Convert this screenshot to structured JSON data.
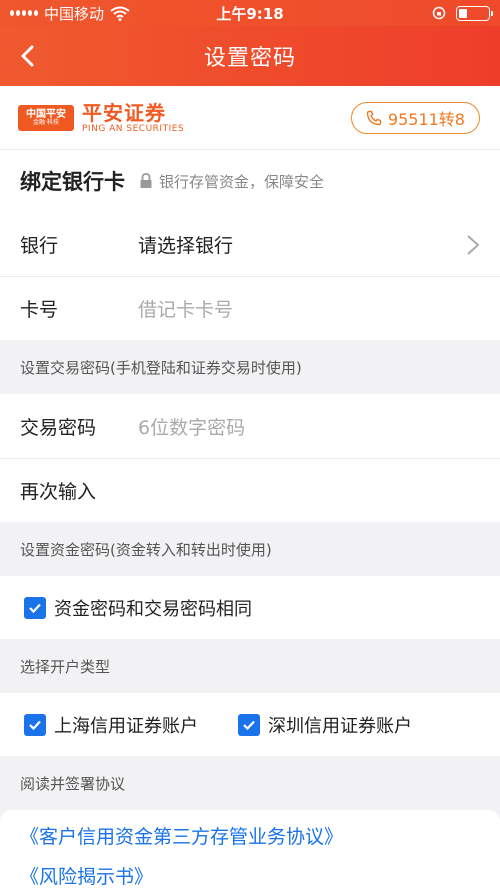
{
  "status": {
    "carrier": "中国移动",
    "time": "上午9:18"
  },
  "nav": {
    "title": "设置密码"
  },
  "brand": {
    "logo_text": "中国平安",
    "logo_sub": "金融·科技",
    "name_cn": "平安证券",
    "name_en": "PING AN SECURITIES",
    "hotline": "95511转8",
    "accent": "#f05a22"
  },
  "bind_card": {
    "title": "绑定银行卡",
    "note": "银行存管资金，保障安全",
    "bank": {
      "label": "银行",
      "value": "请选择银行"
    },
    "card": {
      "label": "卡号",
      "placeholder": "借记卡卡号"
    }
  },
  "trade_pwd": {
    "group_label": "设置交易密码(手机登陆和证券交易时使用)",
    "pwd": {
      "label": "交易密码",
      "placeholder": "6位数字密码"
    },
    "confirm": {
      "label": "再次输入",
      "placeholder": ""
    }
  },
  "fund_pwd": {
    "group_label": "设置资金密码(资金转入和转出时使用)",
    "same_label": "资金密码和交易密码相同",
    "same_checked": true
  },
  "account_type": {
    "group_label": "选择开户类型",
    "options": [
      {
        "label": "上海信用证券账户",
        "checked": true
      },
      {
        "label": "深圳信用证券账户",
        "checked": true
      }
    ]
  },
  "agreements": {
    "group_label": "阅读并签署协议",
    "items": [
      "《客户信用资金第三方存管业务协议》",
      "《风险揭示书》"
    ],
    "link_color": "#1a73e8"
  }
}
